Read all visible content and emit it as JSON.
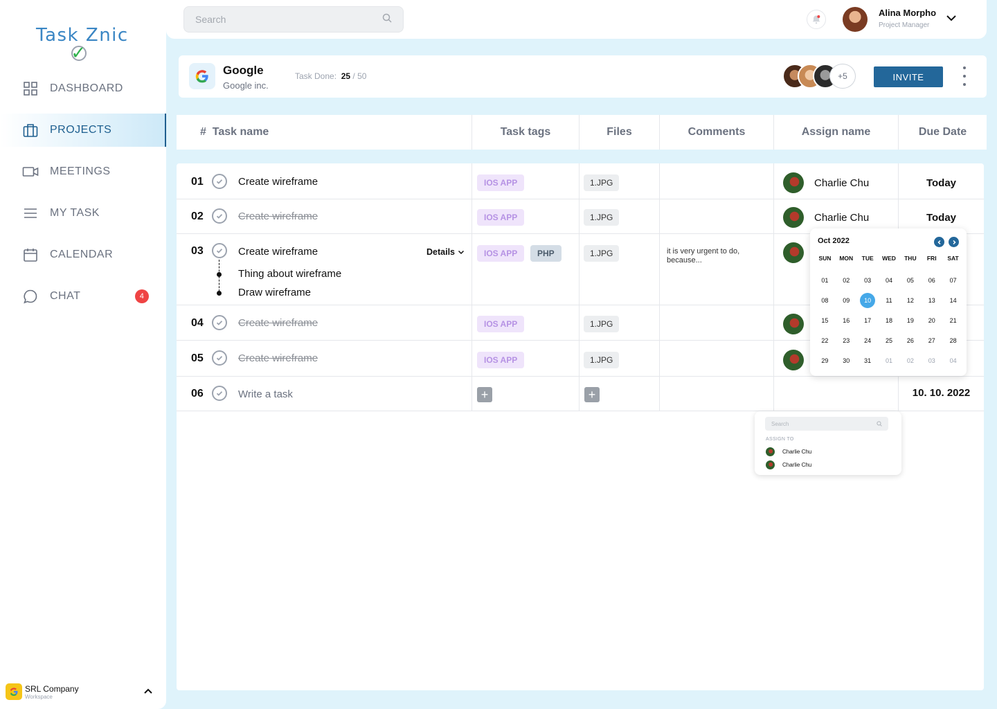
{
  "app": {
    "logo_text_pre": "Task Z",
    "logo_text_post": "nic",
    "logo_check": "✓"
  },
  "sidebar": {
    "items": [
      {
        "label": "DASHBOARD",
        "icon": "grid-icon"
      },
      {
        "label": "PROJECTS",
        "icon": "briefcase-icon",
        "active": true
      },
      {
        "label": "MEETINGS",
        "icon": "video-icon"
      },
      {
        "label": "MY TASK",
        "icon": "list-icon"
      },
      {
        "label": "CALENDAR",
        "icon": "calendar-icon"
      },
      {
        "label": "CHAT",
        "icon": "chat-icon",
        "badge": "4"
      }
    ],
    "workspace": {
      "name": "SRL Company",
      "type": "Workspace"
    }
  },
  "topbar": {
    "search_placeholder": "Search",
    "user": {
      "name": "Alina Morpho",
      "role": "Project Manager"
    }
  },
  "project": {
    "name": "Google",
    "company": "Google inc.",
    "task_done_label": "Task Done:",
    "task_done": "25",
    "task_total": "/ 50",
    "more_members": "+5",
    "invite_label": "INVITE"
  },
  "table": {
    "headers": {
      "hash": "#",
      "task": "Task name",
      "tags": "Task tags",
      "files": "Files",
      "comments": "Comments",
      "assign": "Assign name",
      "due": "Due Date"
    },
    "rows": [
      {
        "num": "01",
        "task": "Create wireframe",
        "tag": "IOS APP",
        "file": "1.JPG",
        "assignee": "Charlie Chu",
        "due": "Today"
      },
      {
        "num": "02",
        "task": "Create wireframe",
        "tag": "IOS APP",
        "file": "1.JPG",
        "assignee": "Charlie Chu",
        "due": "Today"
      },
      {
        "num": "03",
        "task": "Create wireframe",
        "details": "Details",
        "tag": "IOS APP",
        "tag2": "PHP",
        "file": "1.JPG",
        "comment": "it is very urgent to do, because...",
        "subtasks": [
          "Thing about wireframe",
          "Draw wireframe"
        ]
      },
      {
        "num": "04",
        "task": "Create wireframe",
        "tag": "IOS APP",
        "file": "1.JPG"
      },
      {
        "num": "05",
        "task": "Create wireframe",
        "tag": "IOS APP",
        "file": "1.JPG"
      },
      {
        "num": "06",
        "task_placeholder": "Write a task",
        "due": "10. 10. 2022"
      }
    ]
  },
  "calendar": {
    "month": "Oct 2022",
    "weekdays": [
      "SUN",
      "MON",
      "TUE",
      "WED",
      "THU",
      "FRI",
      "SAT"
    ],
    "days": [
      "01",
      "02",
      "03",
      "04",
      "05",
      "06",
      "07",
      "08",
      "09",
      "10",
      "11",
      "12",
      "13",
      "14",
      "15",
      "16",
      "17",
      "18",
      "19",
      "20",
      "21",
      "22",
      "23",
      "24",
      "25",
      "26",
      "27",
      "28",
      "29",
      "30",
      "31",
      "01",
      "02",
      "03",
      "04"
    ],
    "selected": "10"
  },
  "assign_popup": {
    "search_placeholder": "Search",
    "label": "ASSIGN TO",
    "people": [
      "Charlie Chu",
      "Charlie Chu"
    ]
  }
}
